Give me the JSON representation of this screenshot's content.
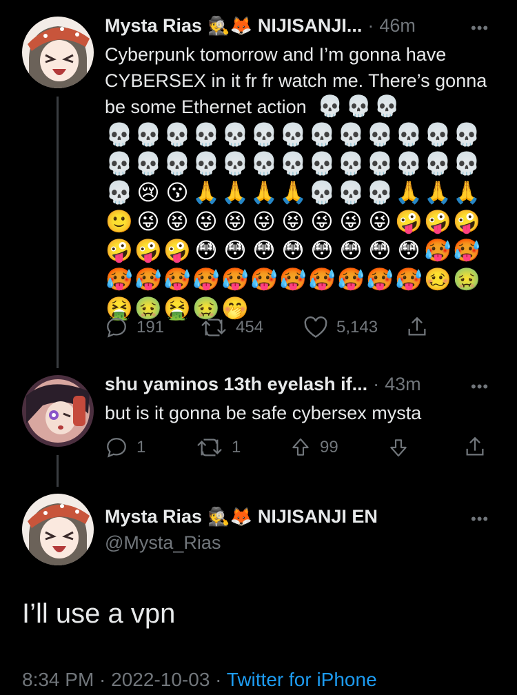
{
  "tweet1": {
    "name": "Mysta Rias",
    "name_emoji": "🕵🦊",
    "org": "NIJISANJI...",
    "time": "46m",
    "text": "Cyberpunk tomorrow and I’m gonna have CYBERSEX in it fr fr watch me. There’s gonna be some Ethernet action",
    "emoji_line_tail": "💀💀💀",
    "emoji_rows": [
      "💀💀💀💀💀💀💀💀💀💀💀💀💀",
      "💀💀💀💀💀💀💀💀💀💀💀💀💀",
      "💀😢😗🙏🙏🙏🙏💀💀💀🙏🙏🙏",
      "🙂😜😝😜😝😜😝😜😜😜🤪🤪🤪",
      "🤪🤪🤪😳😳😳😳😳😳😳😳🥵🥵",
      "🥵🥵🥵🥵🥵🥵🥵🥵🥵🥵🥵🥴🤢",
      "🤮🤢🤮🤢🤭"
    ],
    "replies": "191",
    "retweets": "454",
    "likes": "5,143"
  },
  "tweet2": {
    "name": "shu yaminos 13th eyelash if...",
    "time": "43m",
    "text": "but is it gonna be safe cybersex mysta",
    "replies": "1",
    "retweets": "1",
    "upvotes": "99"
  },
  "tweet3": {
    "name": "Mysta Rias",
    "name_emoji": "🕵🦊",
    "org": "NIJISANJI EN",
    "handle": "@Mysta_Rias",
    "text": "I’ll use a vpn",
    "timestamp": "8:34 PM · 2022-10-03 · ",
    "source": "Twitter for iPhone"
  },
  "separator": "·",
  "more_glyph": "•••",
  "colors": {
    "accent": "#1d9bf0",
    "muted": "#71767b",
    "text": "#e7e9ea",
    "background": "#000000"
  }
}
